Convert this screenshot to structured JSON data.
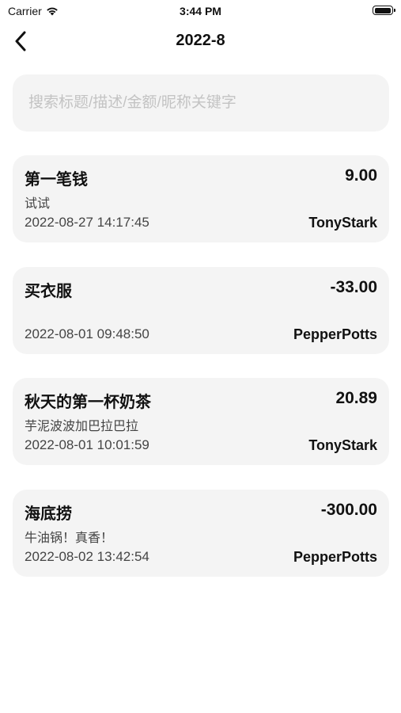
{
  "status_bar": {
    "carrier": "Carrier",
    "time": "3:44 PM",
    "battery_level": 1.0
  },
  "nav": {
    "title": "2022-8",
    "back_icon": "chevron-left-icon"
  },
  "search": {
    "value": "",
    "placeholder": "搜索标题/描述/金额/昵称关键字"
  },
  "records": [
    {
      "title": "第一笔钱",
      "amount": "9.00",
      "description": "试试",
      "time": "2022-08-27 14:17:45",
      "user": "TonyStark"
    },
    {
      "title": "买衣服",
      "amount": "-33.00",
      "description": "",
      "time": "2022-08-01 09:48:50",
      "user": "PepperPotts"
    },
    {
      "title": "秋天的第一杯奶茶",
      "amount": "20.89",
      "description": "芋泥波波加巴拉巴拉",
      "time": "2022-08-01 10:01:59",
      "user": "TonyStark"
    },
    {
      "title": "海底捞",
      "amount": "-300.00",
      "description": "牛油锅！真香！",
      "time": "2022-08-02 13:42:54",
      "user": "PepperPotts"
    }
  ]
}
